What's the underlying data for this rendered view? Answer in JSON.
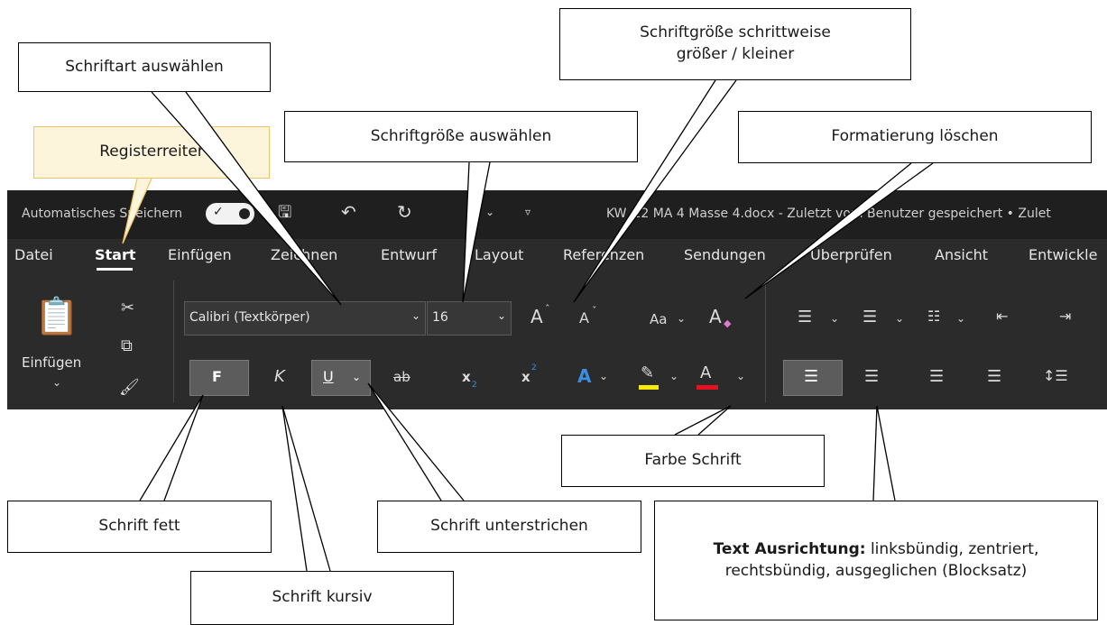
{
  "titlebar": {
    "autosave_label": "Automatisches Speichern",
    "file_title": "KW_22 MA 4 Masse 4.docx  -  Zuletzt vom Benutzer gespeichert • Zulet"
  },
  "tabs": [
    "Datei",
    "Start",
    "Einfügen",
    "Zeichnen",
    "Entwurf",
    "Layout",
    "Referenzen",
    "Sendungen",
    "Überprüfen",
    "Ansicht",
    "Entwickle"
  ],
  "clipboard": {
    "paste_label": "Einfügen"
  },
  "font": {
    "name": "Calibri (Textkörper)",
    "size": "16"
  },
  "glyphs": {
    "bold": "F",
    "italic": "K",
    "underline": "U",
    "strike": "ab",
    "subscript": "x",
    "sub": "2",
    "superscript": "x",
    "sup": "2",
    "grow": "A",
    "shrink": "A",
    "case": "Aa",
    "clear": "A",
    "color": "A",
    "effects": "A"
  },
  "colors": {
    "highlight": "#f5e90a",
    "font_color": "#e81123",
    "accent_blue": "#3b8ee0",
    "callout_fill": "#fdf4dc"
  },
  "callouts": {
    "font_select": "Schriftart auswählen",
    "tab": "Registerreiter",
    "size_select": "Schriftgröße auswählen",
    "size_step_1": "Schriftgröße schrittweise",
    "size_step_2": "größer / kleiner",
    "clear_format": "Formatierung löschen",
    "bold": "Schrift fett",
    "italic": "Schrift kursiv",
    "underline": "Schrift unterstrichen",
    "color": "Farbe Schrift",
    "align_bold": "Text Ausrichtung:",
    "align_rest": " linksbündig, zentriert, rechtsbündig, ausgeglichen (Blocksatz)"
  }
}
